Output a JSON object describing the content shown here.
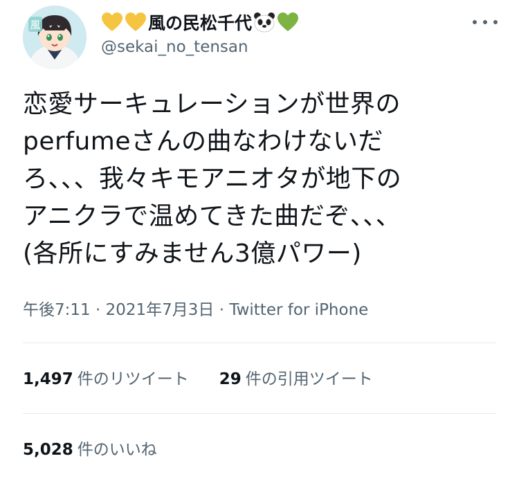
{
  "user": {
    "display_name": "風の民松千代",
    "handle": "@sekai_no_tensan",
    "name_emojis": [
      "yellow-heart",
      "yellow-heart",
      "panda-face",
      "green-heart"
    ],
    "avatar_badge": "風"
  },
  "tweet": {
    "lines": [
      "恋愛サーキュレーションが世界の",
      "perfumeさんの曲なわけないだ",
      "ろ、、、我々キモアニオタが地下の",
      "アニクラで温めてきた曲だぞ、、、",
      "(各所にすみません3億パワー)"
    ],
    "time": "午後7:11",
    "separator": "·",
    "date": "2021年7月3日",
    "source": "Twitter for iPhone"
  },
  "stats": {
    "retweets_count": "1,497",
    "retweets_label": "件のリツイート",
    "quotes_count": "29",
    "quotes_label": "件の引用ツイート",
    "likes_count": "5,028",
    "likes_label": "件のいいね"
  },
  "colors": {
    "text": "#0f1419",
    "secondary": "#536471",
    "divider": "#e6ecf0",
    "yellow_heart": "#f5c542",
    "green_heart": "#7cb342"
  }
}
